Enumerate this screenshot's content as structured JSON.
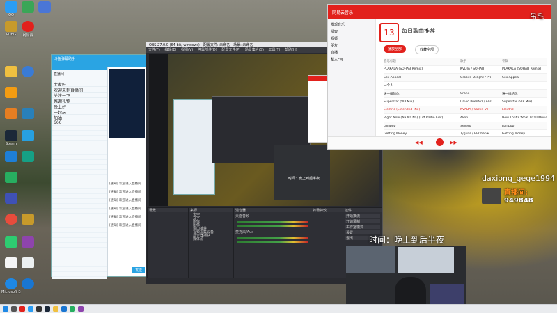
{
  "desktop": {
    "icons": [
      {
        "label": "QQ",
        "color": "#2a9df4"
      },
      {
        "label": "PUBG",
        "color": "#c79a2b"
      },
      {
        "label": "网易云",
        "color": "#e2211c"
      },
      {
        "label": "Steam",
        "color": "#1b2838"
      },
      {
        "label": "",
        "color": "#f39c12"
      },
      {
        "label": "",
        "color": "#27ae60"
      },
      {
        "label": "",
        "color": "#3498db"
      },
      {
        "label": "",
        "color": "#8e44ad"
      },
      {
        "label": "",
        "color": "#16a085"
      },
      {
        "label": "Microsoft Edge",
        "color": "#1e88e5"
      }
    ]
  },
  "qq": {
    "title": "斗鱼弹幕助手",
    "room_label": "直播间",
    "rows": [
      "大家好",
      "欢迎来到直播间",
      "关注一下",
      "感谢礼物",
      "晚上好",
      "一起玩",
      "加油",
      "666"
    ],
    "messages": [
      "[通知] 欢迎进入直播间",
      "[通知] 欢迎进入直播间",
      "[通知] 欢迎进入直播间",
      "[通知] 欢迎进入直播间",
      "[通知] 欢迎进入直播间",
      "[通知] 欢迎进入直播间"
    ],
    "send_button": "发送"
  },
  "obs": {
    "title": "OBS 27.0.0 (64-bit, windows) - 配置文件: 未命名 - 场景: 未命名",
    "menu": [
      "文件(F)",
      "编辑(E)",
      "视图(V)",
      "停靠部件(D)",
      "配置文件(P)",
      "场景集合(S)",
      "工具(T)",
      "帮助(H)"
    ],
    "docks": {
      "scenes": "场景",
      "sources": "来源",
      "mixer": "混音器",
      "transitions": "转场特效",
      "controls": "控件"
    },
    "sources": [
      "文字",
      "文字",
      "图像",
      "图像",
      "窗口捕获",
      "视频采集设备",
      "显示器捕获",
      "媒体源"
    ],
    "mixer_tracks": [
      "桌面音频",
      "麦克风/Aux"
    ],
    "controls": [
      "开始推流",
      "开始录制",
      "工作室模式",
      "设置",
      "退出"
    ]
  },
  "music": {
    "app": "网易云音乐",
    "title": "每日歌曲推荐",
    "date": "13",
    "play_all": "播放全部",
    "collect": "收藏全部",
    "nav": [
      "发现音乐",
      "播客",
      "视频",
      "朋友",
      "直播",
      "私人FM"
    ],
    "columns": [
      "音乐标题",
      "歌手",
      "专辑"
    ],
    "tracks": [
      [
        "PLAKALA (SOHAB Remix)",
        "KVDIA / SOHAB",
        "PLAKALA (SOHAB Remix)"
      ],
      [
        "Sex Appeal",
        "Groove Delight / PR",
        "Sex Appeal"
      ],
      [
        "一个人",
        "",
        ""
      ],
      [
        "谁一样的你",
        "Crane",
        "谁一样的你"
      ],
      [
        "Superstar (VIP Mix)",
        "David Puentez / Alis",
        "Superstar (VIP Mix)"
      ],
      [
        "Electric (Extended Mix)",
        "KVADA / Vastin Vil",
        "Electric"
      ],
      [
        "Right Now (Na Na Na) (Lift Radio Edit)",
        "Akon",
        "Now That's What I Call Music"
      ],
      [
        "Lollipop",
        "Severo",
        "Lollipop"
      ],
      [
        "Getting Money",
        "Tyguns / BBChanw",
        "Getting Money"
      ]
    ]
  },
  "overlay": {
    "streamer": "daxiong_gege1994",
    "follow_label": "直播间:",
    "room_number": "949848",
    "time_label": "时间：晚上到后半夜",
    "corner_text": "吊毛"
  },
  "colors": {
    "qq_blue": "#2aa4e3",
    "netease_red": "#e2211c",
    "obs_dark": "#2a2b30"
  }
}
